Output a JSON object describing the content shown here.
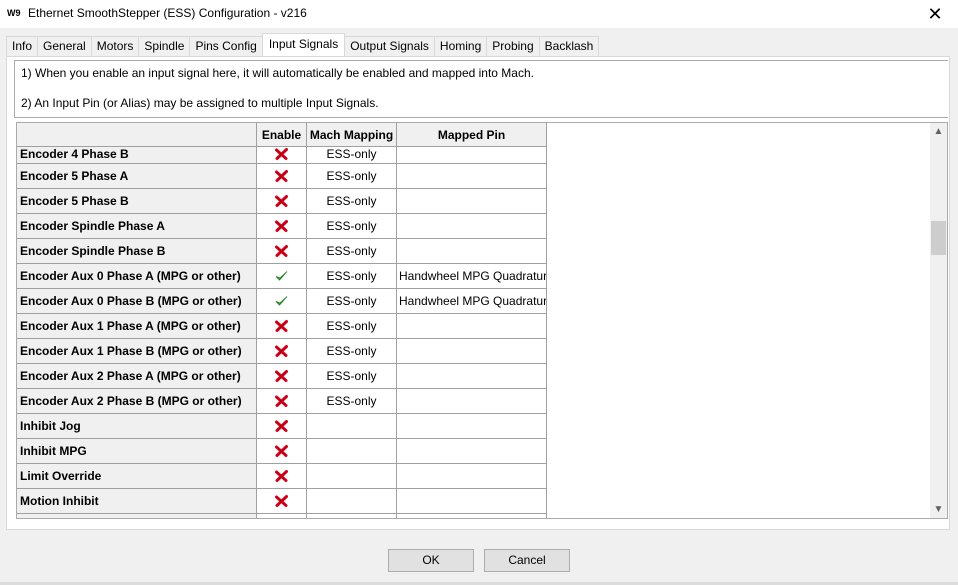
{
  "window": {
    "icon_label": "W9",
    "title": "Ethernet SmoothStepper (ESS) Configuration - v216",
    "close_label": "✕"
  },
  "tabs": [
    {
      "label": "Info"
    },
    {
      "label": "General"
    },
    {
      "label": "Motors"
    },
    {
      "label": "Spindle"
    },
    {
      "label": "Pins Config"
    },
    {
      "label": "Input Signals",
      "active": true
    },
    {
      "label": "Output Signals"
    },
    {
      "label": "Homing"
    },
    {
      "label": "Probing"
    },
    {
      "label": "Backlash"
    }
  ],
  "info": {
    "line1": "1) When you enable an input signal here, it will automatically be enabled and mapped into Mach.",
    "line2": "2) An Input Pin (or Alias) may be assigned to multiple Input Signals."
  },
  "table": {
    "headers": {
      "name": "",
      "enable": "Enable",
      "mapping": "Mach Mapping",
      "pin": "Mapped Pin"
    },
    "rows": [
      {
        "name": "Encoder 4 Phase B",
        "enabled": false,
        "mapping": "ESS-only",
        "pin": ""
      },
      {
        "name": "Encoder 5 Phase A",
        "enabled": false,
        "mapping": "ESS-only",
        "pin": ""
      },
      {
        "name": "Encoder 5 Phase B",
        "enabled": false,
        "mapping": "ESS-only",
        "pin": ""
      },
      {
        "name": "Encoder Spindle Phase A",
        "enabled": false,
        "mapping": "ESS-only",
        "pin": ""
      },
      {
        "name": "Encoder Spindle Phase B",
        "enabled": false,
        "mapping": "ESS-only",
        "pin": ""
      },
      {
        "name": "Encoder Aux 0 Phase A (MPG or other)",
        "enabled": true,
        "mapping": "ESS-only",
        "pin": "Handwheel MPG Quadratur"
      },
      {
        "name": "Encoder Aux 0 Phase B (MPG or other)",
        "enabled": true,
        "mapping": "ESS-only",
        "pin": "Handwheel MPG Quadratur"
      },
      {
        "name": "Encoder Aux 1 Phase A (MPG or other)",
        "enabled": false,
        "mapping": "ESS-only",
        "pin": ""
      },
      {
        "name": "Encoder Aux 1 Phase B (MPG or other)",
        "enabled": false,
        "mapping": "ESS-only",
        "pin": ""
      },
      {
        "name": "Encoder Aux 2 Phase A (MPG or other)",
        "enabled": false,
        "mapping": "ESS-only",
        "pin": ""
      },
      {
        "name": "Encoder Aux 2 Phase B (MPG or other)",
        "enabled": false,
        "mapping": "ESS-only",
        "pin": ""
      },
      {
        "name": "Inhibit Jog",
        "enabled": false,
        "mapping": "",
        "pin": ""
      },
      {
        "name": "Inhibit MPG",
        "enabled": false,
        "mapping": "",
        "pin": ""
      },
      {
        "name": "Limit Override",
        "enabled": false,
        "mapping": "",
        "pin": ""
      },
      {
        "name": "Motion Inhibit",
        "enabled": false,
        "mapping": "",
        "pin": ""
      },
      {
        "name": "",
        "enabled": null,
        "mapping": "",
        "pin": ""
      }
    ]
  },
  "icons": {
    "enabled": "green-check-icon",
    "disabled": "red-x-icon"
  },
  "colors": {
    "check": "#2db82d",
    "cross": "#e0001b"
  },
  "buttons": {
    "ok": "OK",
    "cancel": "Cancel"
  }
}
